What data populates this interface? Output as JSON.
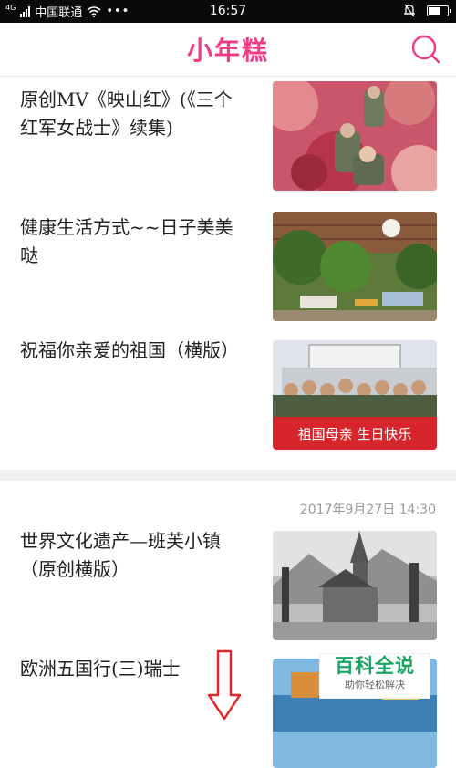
{
  "status_bar": {
    "signal_label": "4G",
    "carrier": "中国联通",
    "more": "•••",
    "time": "16:57",
    "battery_level": 0.7
  },
  "header": {
    "title": "小年糕",
    "accent_color": "#f03e86"
  },
  "feed": {
    "items": [
      {
        "title": "原创MV《映山红》(《三个红军女战士》续集)",
        "thumb": "red-autumn-soldiers"
      },
      {
        "title": "健康生活方式~~日子美美哒",
        "thumb": "garden-patio"
      },
      {
        "title": "祝福你亲爱的祖国（横版）",
        "thumb": "ship-crowd"
      },
      {
        "title": "世界文化遗产—班芙小镇（原创横版）",
        "thumb": "bw-church"
      },
      {
        "title": "欧洲五国行(三)瑞士",
        "thumb": "swiss-lake"
      }
    ],
    "section_timestamp": "2017年9月27日 14:30",
    "banner_text": "祖国母亲 生日快乐"
  },
  "watermark": {
    "title": "百科全说",
    "subtitle": "助你轻松解决"
  }
}
